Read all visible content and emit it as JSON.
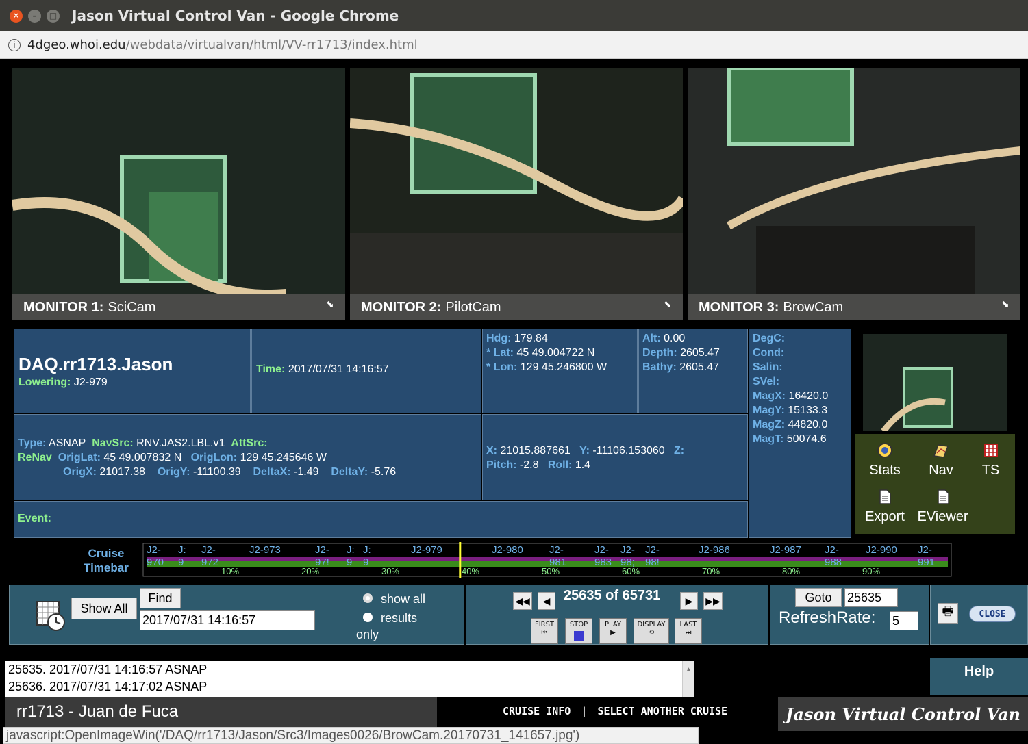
{
  "window": {
    "title": "Jason Virtual Control Van - Google Chrome"
  },
  "url": {
    "host": "4dgeo.whoi.edu",
    "path": "/webdata/virtualvan/html/VV-rr1713/index.html"
  },
  "monitors": [
    {
      "label": "MONITOR 1:",
      "name": "SciCam"
    },
    {
      "label": "MONITOR 2:",
      "name": "PilotCam"
    },
    {
      "label": "MONITOR 3:",
      "name": "BrowCam"
    }
  ],
  "daq": {
    "title": "DAQ.rr1713.Jason",
    "lowering_label": "Lowering:",
    "lowering": "J2-979"
  },
  "time": {
    "label": "Time:",
    "value": "2017/07/31 14:16:57"
  },
  "nav": {
    "hdg_label": "Hdg:",
    "hdg": "179.84",
    "lat_label": "* Lat:",
    "lat": "45 49.004722 N",
    "lon_label": "* Lon:",
    "lon": "129 45.246800 W"
  },
  "depth": {
    "alt_label": "Alt:",
    "alt": "0.00",
    "depth_label": "Depth:",
    "depth": "2605.47",
    "bathy_label": "Bathy:",
    "bathy": "2605.47"
  },
  "sensors": {
    "degc_label": "DegC:",
    "cond_label": "Cond:",
    "salin_label": "Salin:",
    "svel_label": "SVel:",
    "magx_label": "MagX:",
    "magx": "16420.0",
    "magy_label": "MagY:",
    "magy": "15133.3",
    "magz_label": "MagZ:",
    "magz": "44820.0",
    "magt_label": "MagT:",
    "magt": "50074.6"
  },
  "renav": {
    "type_label": "Type:",
    "type": "ASNAP",
    "navsrc_label": "NavSrc:",
    "navsrc": "RNV.JAS2.LBL.v1",
    "attsrc_label": "AttSrc:",
    "renav_label": "ReNav",
    "origlat_label": "OrigLat:",
    "origlat": "45 49.007832 N",
    "origlon_label": "OrigLon:",
    "origlon": "129 45.245646 W",
    "origx_label": "OrigX:",
    "origx": "21017.38",
    "origy_label": "OrigY:",
    "origy": "-11100.39",
    "deltax_label": "DeltaX:",
    "deltax": "-1.49",
    "deltay_label": "DeltaY:",
    "deltay": "-5.76"
  },
  "xyz": {
    "x_label": "X:",
    "x": "21015.887661",
    "y_label": "Y:",
    "y": "-11106.153060",
    "z_label": "Z:",
    "pitch_label": "Pitch:",
    "pitch": "-2.8",
    "roll_label": "Roll:",
    "roll": "1.4"
  },
  "event": {
    "label": "Event:"
  },
  "tools": {
    "stats": "Stats",
    "nav": "Nav",
    "ts": "TS",
    "export": "Export",
    "eviewer": "EViewer"
  },
  "timebar": {
    "label_line1": "Cruise",
    "label_line2": "Timebar",
    "dives_top": [
      "J2-",
      "J:",
      "J2-",
      "J2-973",
      "J2-",
      "J:",
      "J:",
      "J2-979",
      "J2-980",
      "J2-",
      "J2-",
      "J2-",
      "J2-",
      "J2-986",
      "J2-987",
      "J2-",
      "J2-990",
      "J2-"
    ],
    "dives_bottom": [
      "970",
      "9",
      "972",
      "97!",
      "9",
      "9",
      "981",
      "983",
      "98;",
      "98!",
      "988",
      "991"
    ],
    "percents": [
      "10%",
      "20%",
      "30%",
      "40%",
      "50%",
      "60%",
      "70%",
      "80%",
      "90%"
    ],
    "marker_fraction": 0.39
  },
  "search": {
    "show_all": "Show All",
    "find": "Find",
    "date": "2017/07/31 14:16:57",
    "radio_show_all": "show all",
    "radio_results": "results",
    "radio_only": "only"
  },
  "playback": {
    "counter": "25635 of 65731",
    "first": "FIRST",
    "stop": "STOP",
    "play": "PLAY",
    "display": "DISPLAY",
    "last": "LAST"
  },
  "goto": {
    "button": "Goto",
    "value": "25635",
    "refresh_label": "RefreshRate:",
    "refresh_value": "5"
  },
  "close_label": "CLOSE",
  "log": [
    "25635. 2017/07/31 14:16:57 ASNAP",
    "25636. 2017/07/31 14:17:02 ASNAP"
  ],
  "help": "Help",
  "footer": {
    "cruise": "rr1713 - Juan de Fuca",
    "cruise_info": "CRUISE INFO",
    "separator": "|",
    "select_cruise": "SELECT ANOTHER CRUISE",
    "brand": "Jason Virtual Control Van"
  },
  "status": "javascript:OpenImageWin('/DAQ/rr1713/Jason/Src3/Images0026/BrowCam.20170731_141657.jpg')",
  "colors": {
    "panel": "#274b70",
    "label_green": "#8ef08e",
    "label_blue": "#6fb1e6",
    "control": "#2e5a6d"
  }
}
